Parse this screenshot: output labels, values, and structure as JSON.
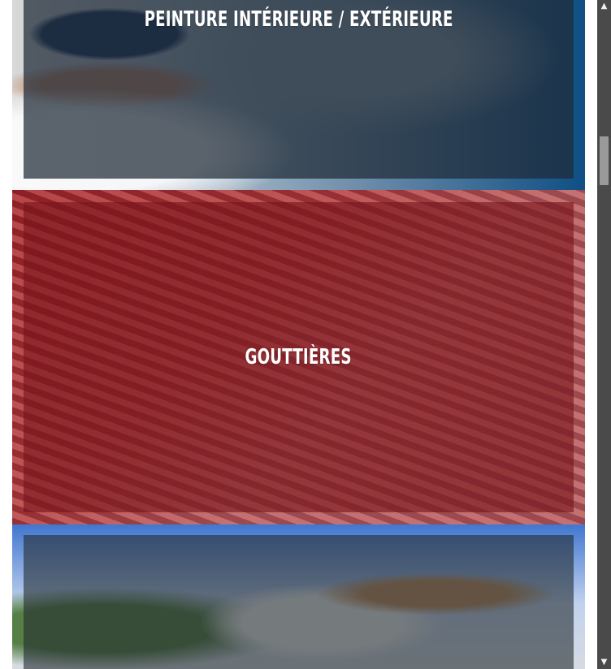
{
  "cards": [
    {
      "title": "PEINTURE INTÉRIEURE / EXTÉRIEURE"
    },
    {
      "title": "GOUTTIÈRES"
    },
    {
      "title": ""
    }
  ],
  "scrollbar": {
    "up_icon": "triangle-up",
    "down_icon": "triangle-down",
    "up_symbol": "▲",
    "down_symbol": "▼"
  }
}
